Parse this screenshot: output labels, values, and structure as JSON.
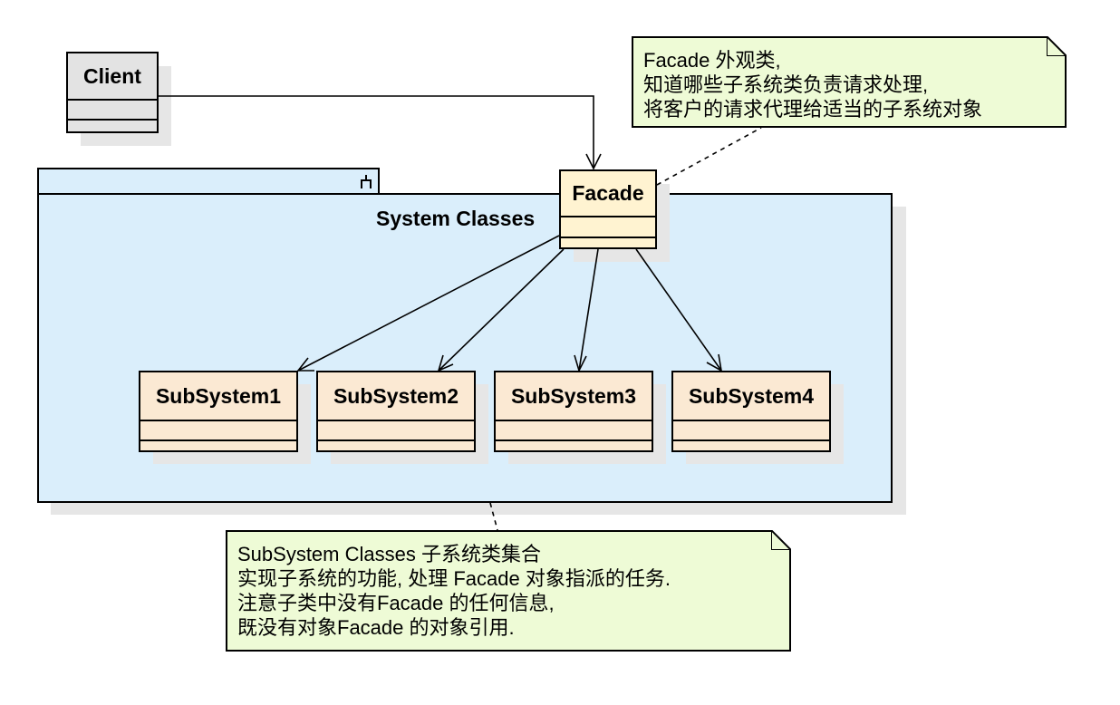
{
  "package": {
    "name": "System Classes"
  },
  "classes": {
    "client": "Client",
    "facade": "Facade",
    "subsystems": [
      "SubSystem1",
      "SubSystem2",
      "SubSystem3",
      "SubSystem4"
    ]
  },
  "notes": {
    "facade": {
      "lines": [
        "Facade 外观类,",
        "知道哪些子系统类负责请求处理,",
        "将客户的请求代理给适当的子系统对象"
      ]
    },
    "subsystem": {
      "lines": [
        "SubSystem Classes 子系统类集合",
        "实现子系统的功能, 处理 Facade 对象指派的任务.",
        "注意子类中没有Facade 的任何信息,",
        "既没有对象Facade 的对象引用."
      ]
    }
  },
  "colors": {
    "package_fill": "#daeefb",
    "subsystem_fill": "#fbe9d3",
    "facade_fill": "#fff3d1",
    "client_fill": "#e3e3e3",
    "note_fill": "#eefbd6"
  }
}
